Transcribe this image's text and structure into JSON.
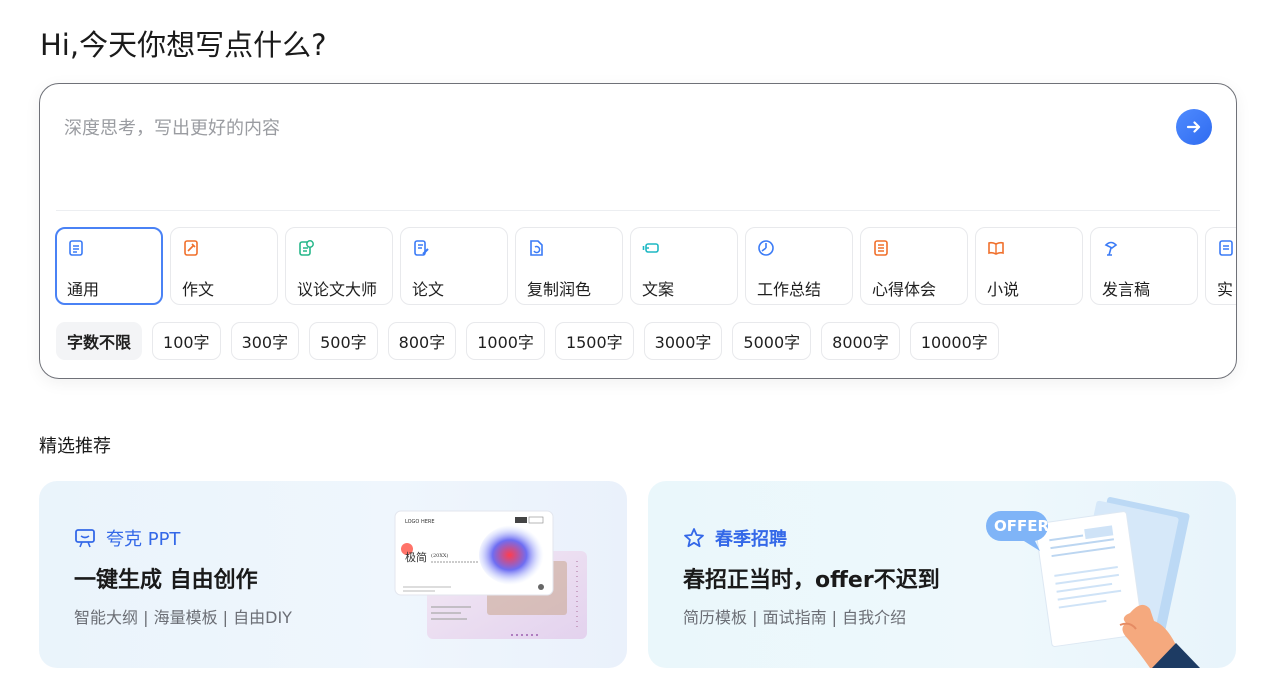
{
  "greeting": "Hi,今天你想写点什么?",
  "composer": {
    "placeholder": "深度思考，写出更好的内容",
    "send_icon": "arrow-right-icon",
    "accent": "#3b7bf6"
  },
  "writing_types": [
    {
      "label": "通用",
      "icon": "document-icon",
      "color": "#3b7bf6",
      "active": true
    },
    {
      "label": "作文",
      "icon": "edit-note-icon",
      "color": "#f0702c"
    },
    {
      "label": "议论文大师",
      "icon": "document-check-icon",
      "color": "#27b78a"
    },
    {
      "label": "论文",
      "icon": "paper-pen-icon",
      "color": "#3b7bf6"
    },
    {
      "label": "复制润色",
      "icon": "document-refresh-icon",
      "color": "#3b7bf6"
    },
    {
      "label": "文案",
      "icon": "tag-icon",
      "color": "#1fb8c4"
    },
    {
      "label": "工作总结",
      "icon": "pie-chart-icon",
      "color": "#3b7bf6"
    },
    {
      "label": "心得体会",
      "icon": "notebook-icon",
      "color": "#f0702c"
    },
    {
      "label": "小说",
      "icon": "book-icon",
      "color": "#f0702c"
    },
    {
      "label": "发言稿",
      "icon": "microphone-icon",
      "color": "#3b7bf6"
    },
    {
      "label": "实",
      "icon": "report-icon",
      "color": "#3b7bf6"
    }
  ],
  "word_counts": [
    {
      "label": "字数不限",
      "active": true
    },
    {
      "label": "100字"
    },
    {
      "label": "300字"
    },
    {
      "label": "500字"
    },
    {
      "label": "800字"
    },
    {
      "label": "1000字"
    },
    {
      "label": "1500字"
    },
    {
      "label": "3000字"
    },
    {
      "label": "5000字"
    },
    {
      "label": "8000字"
    },
    {
      "label": "10000字"
    }
  ],
  "recommend": {
    "title": "精选推荐",
    "cards": [
      {
        "tag": "夸克 PPT",
        "tag_icon": "presentation-icon",
        "headline": "一键生成 自由创作",
        "subtitle": "智能大纲 | 海量模板 | 自由DIY",
        "thumb": {
          "logo": "LOGO HERE",
          "title": "极简",
          "year": "(20XX)"
        }
      },
      {
        "tag": "春季招聘",
        "tag_icon": "star-icon",
        "headline": "春招正当时，offer不迟到",
        "subtitle": "简历模板 | 面试指南 | 自我介绍",
        "badge": "OFFER"
      }
    ]
  }
}
